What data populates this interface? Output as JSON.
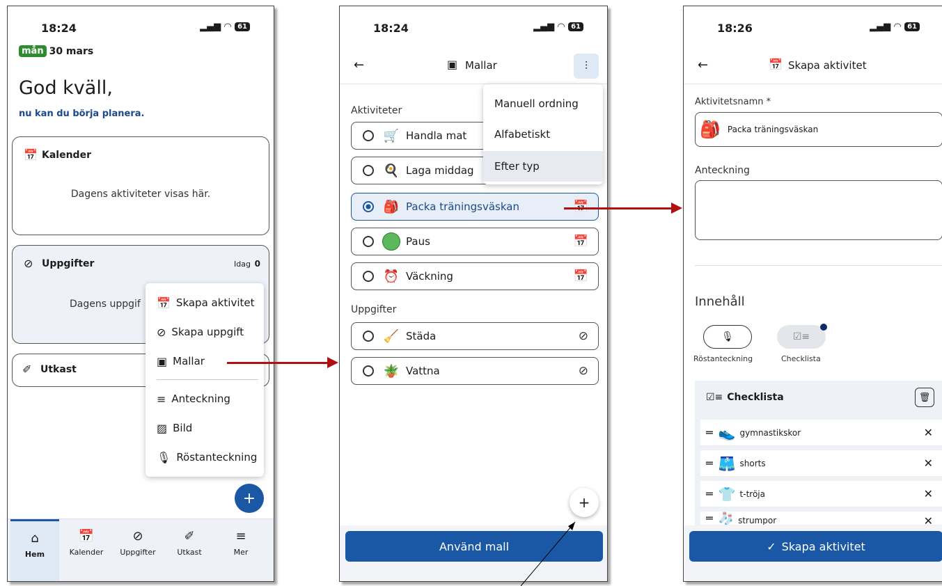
{
  "status": {
    "time1": "18:24",
    "time2": "18:24",
    "time3": "18:26",
    "battery": "61"
  },
  "phone1": {
    "date_badge": "mån",
    "date_text": "30 mars",
    "greeting": "God kväll,",
    "subtitle": "nu kan du börja planera.",
    "calendar": {
      "title": "Kalender",
      "empty": "Dagens aktiviteter visas här."
    },
    "tasks": {
      "title": "Uppgifter",
      "today_label": "Idag",
      "today_count": "0",
      "empty": "Dagens uppgif"
    },
    "drafts": {
      "title": "Utkast"
    },
    "menu": {
      "create_activity": "Skapa aktivitet",
      "create_task": "Skapa uppgift",
      "templates": "Mallar",
      "note": "Anteckning",
      "image": "Bild",
      "voice": "Röstanteckning"
    },
    "fab": "+",
    "nav": [
      {
        "label": "Hem",
        "icon": "home-icon"
      },
      {
        "label": "Kalender",
        "icon": "calendar-icon"
      },
      {
        "label": "Uppgifter",
        "icon": "check-circle-icon"
      },
      {
        "label": "Utkast",
        "icon": "draft-icon"
      },
      {
        "label": "Mer",
        "icon": "menu-icon"
      }
    ]
  },
  "phone2": {
    "title": "Mallar",
    "sort_menu": [
      "Manuell ordning",
      "Alfabetiskt",
      "Efter typ"
    ],
    "section_activities": "Aktiviteter",
    "activities": [
      "Handla mat",
      "Laga middag",
      "Packa träningsväskan",
      "Paus",
      "Väckning"
    ],
    "section_tasks": "Uppgifter",
    "tasks": [
      "Städa",
      "Vattna"
    ],
    "fab": "+",
    "use_button": "Använd mall"
  },
  "phone3": {
    "title": "Skapa aktivitet",
    "name_label": "Aktivitetsnamn *",
    "name_value": "Packa träningsväskan",
    "note_label": "Anteckning",
    "content_title": "Innehåll",
    "voice_label": "Röstanteckning",
    "checklist_label": "Checklista",
    "checklist_title": "Checklista",
    "items": [
      "gymnastikskor",
      "shorts",
      "t-tröja",
      "strumpor"
    ],
    "create_button": "Skapa aktivitet"
  },
  "colors": {
    "accent": "#1a57a4",
    "arrow": "#b01010",
    "badge_green": "#2e8b2e"
  }
}
